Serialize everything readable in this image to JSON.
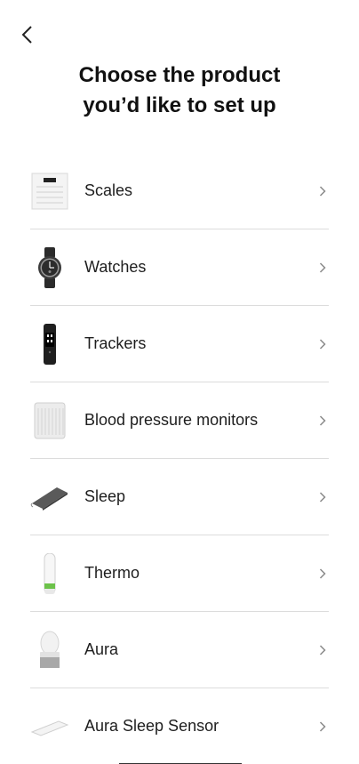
{
  "header": {
    "back_icon": "chevron-left-icon",
    "title_line1": "Choose the product",
    "title_line2": "you’d like to set up"
  },
  "products": [
    {
      "label": "Scales",
      "icon": "scale-icon"
    },
    {
      "label": "Watches",
      "icon": "watch-icon"
    },
    {
      "label": "Trackers",
      "icon": "tracker-icon"
    },
    {
      "label": "Blood pressure monitors",
      "icon": "blood-pressure-monitor-icon"
    },
    {
      "label": "Sleep",
      "icon": "sleep-mat-icon"
    },
    {
      "label": "Thermo",
      "icon": "thermometer-icon"
    },
    {
      "label": "Aura",
      "icon": "aura-lamp-icon"
    },
    {
      "label": "Aura Sleep Sensor",
      "icon": "sleep-sensor-icon"
    }
  ],
  "colors": {
    "divider": "#dcdcdc",
    "text": "#1e1e1e",
    "chevron": "#8a8a8a",
    "accent_green": "#6cc24a"
  }
}
